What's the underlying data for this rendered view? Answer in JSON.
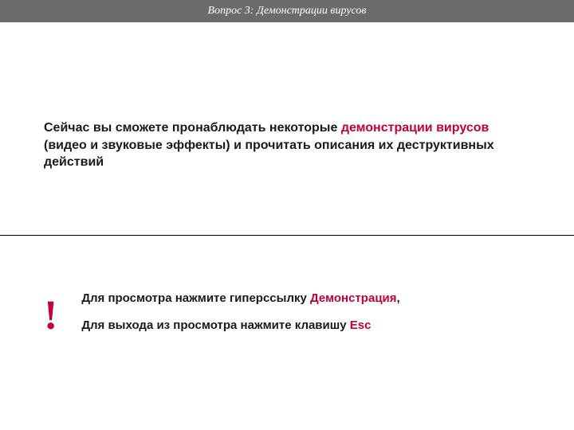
{
  "header": {
    "title": "Вопрос 3: Демонстрации вирусов"
  },
  "main": {
    "intro_text_1": " Сейчас вы сможете пронаблюдать некоторые ",
    "intro_highlight": "демонстрации вирусов",
    "intro_text_2": " (видео и звуковые эффекты) и прочитать описания их деструктивных действий"
  },
  "exclaim": "!",
  "instructions": {
    "line1_a": "Для просмотра нажмите гиперссылку ",
    "line1_hl": "Демонстрация",
    "line1_b": ",",
    "line2_a": "Для выхода из просмотра нажмите клавишу ",
    "line2_hl": "Esc"
  }
}
